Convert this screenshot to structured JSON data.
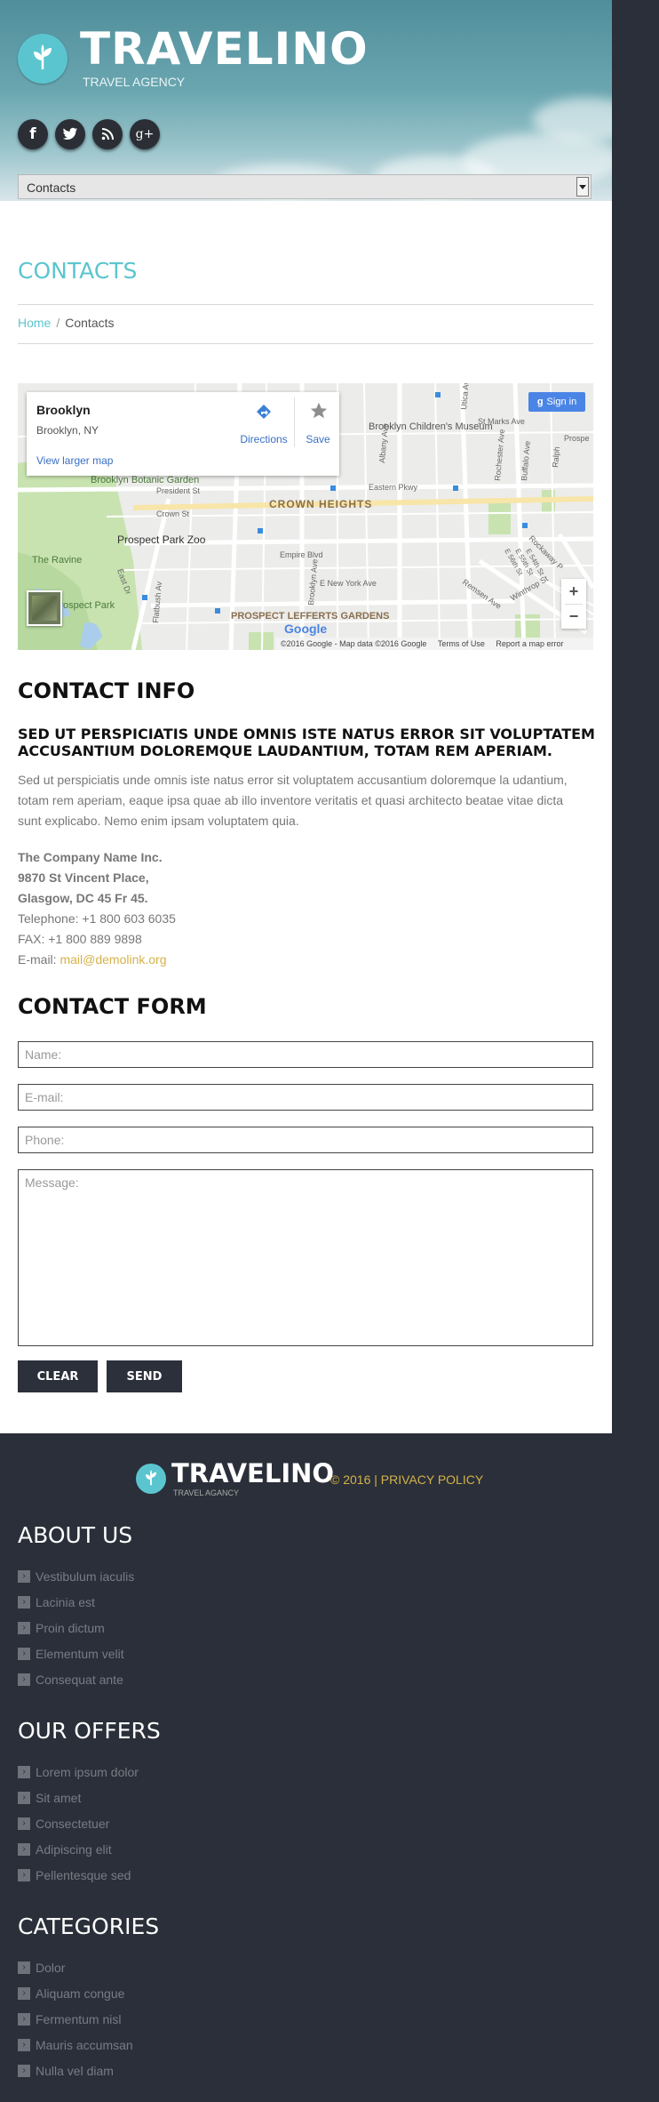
{
  "header": {
    "logo_title": "TRAVELINO",
    "logo_subtitle": "TRAVEL AGENCY",
    "social": [
      {
        "icon": "facebook-icon",
        "glyph": "f"
      },
      {
        "icon": "twitter-icon",
        "glyph": "t"
      },
      {
        "icon": "rss-icon",
        "glyph": ""
      },
      {
        "icon": "google-plus-icon",
        "glyph": "g+"
      }
    ],
    "nav_select_value": "Contacts"
  },
  "main": {
    "page_title": "CONTACTS",
    "breadcrumb": {
      "home": "Home",
      "separator": "/",
      "current": "Contacts"
    },
    "map": {
      "place_name": "Brooklyn",
      "place_region": "Brooklyn, NY",
      "directions_label": "Directions",
      "save_label": "Save",
      "larger_map_link": "View larger map",
      "sign_in_label": "Sign in",
      "zoom_in": "+",
      "zoom_out": "−",
      "footer_attrib": "©2016 Google - Map data ©2016 Google",
      "terms": "Terms of Use",
      "report": "Report a map error",
      "labels": {
        "childrens_museum": "Brooklyn Children's Museum",
        "crown_heights": "CROWN HEIGHTS",
        "botanic_garden": "Brooklyn Botanic Garden",
        "zoo": "Prospect Park Zoo",
        "ravine": "The Ravine",
        "park": "Prospect Park",
        "lefferts": "PROSPECT LEFFERTS GARDENS",
        "eastern_pkwy": "Eastern Pkwy",
        "empire_blvd": "Empire Blvd",
        "e_new_york": "E New York Ave",
        "president_st": "President St",
        "crown_st": "Crown St",
        "st_marks": "St Marks Ave",
        "utica": "Utica Ave",
        "albany": "Albany Ave",
        "rochester": "Rochester Ave",
        "buffalo": "Buffalo Ave",
        "ralph": "Ralph",
        "prospect_pl": "Prospe",
        "rockaway": "Rockaway P",
        "remsen": "Remsen Ave",
        "winthrop": "Winthrop St",
        "e_st_a": "E 56th St",
        "e_st_b": "E 55th St",
        "e_st_c": "E 54th St",
        "brooklyn_ave": "Brooklyn Ave",
        "flatbush": "Flatbush Av",
        "east_dr": "East Dr",
        "google": "Google"
      }
    },
    "contact_info": {
      "heading": "CONTACT INFO",
      "lead": "SED UT PERSPICIATIS UNDE OMNIS ISTE NATUS ERROR SIT VOLUPTATEM ACCUSANTIUM DOLOREMQUE LAUDANTIUM, TOTAM REM APERIAM.",
      "paragraph": "Sed ut perspiciatis unde omnis iste natus error sit voluptatem accusantium doloremque la udantium, totam rem aperiam, eaque ipsa quae ab illo inventore veritatis et quasi architecto beatae vitae dicta sunt explicabo. Nemo enim ipsam voluptatem quia.",
      "company": "The Company Name Inc.",
      "street": "9870 St Vincent Place,",
      "city": "Glasgow, DC 45 Fr 45.",
      "telephone": "Telephone: +1 800 603 6035",
      "fax": "FAX: +1 800 889 9898",
      "email_label": "E-mail: ",
      "email": "mail@demolink.org",
      "email_color": "#d4b24a"
    },
    "contact_form": {
      "heading": "CONTACT FORM",
      "name_placeholder": "Name:",
      "email_placeholder": "E-mail:",
      "phone_placeholder": "Phone:",
      "message_placeholder": "Message:",
      "clear_label": "CLEAR",
      "send_label": "SEND"
    }
  },
  "footer": {
    "logo_title": "TRAVELINO",
    "logo_subtitle": "TRAVEL AGANCY",
    "copyright": "© 2016 | PRIVACY POLICY",
    "sections": [
      {
        "title": "ABOUT US",
        "items": [
          "Vestibulum iaculis",
          "Lacinia est",
          "Proin dictum",
          "Elementum velit",
          "Consequat ante"
        ]
      },
      {
        "title": "OUR OFFERS",
        "items": [
          "Lorem ipsum dolor",
          "Sit amet",
          "Consectetuer",
          "Adipiscing elit",
          "Pellentesque sed"
        ]
      },
      {
        "title": "CATEGORIES",
        "items": [
          "Dolor",
          "Aliquam congue",
          "Fermentum nisl",
          "Mauris accumsan",
          "Nulla vel diam"
        ]
      }
    ]
  },
  "colors": {
    "accent": "#5bc5cf",
    "dark": "#2a2f39",
    "link_gold": "#d4b24a"
  }
}
